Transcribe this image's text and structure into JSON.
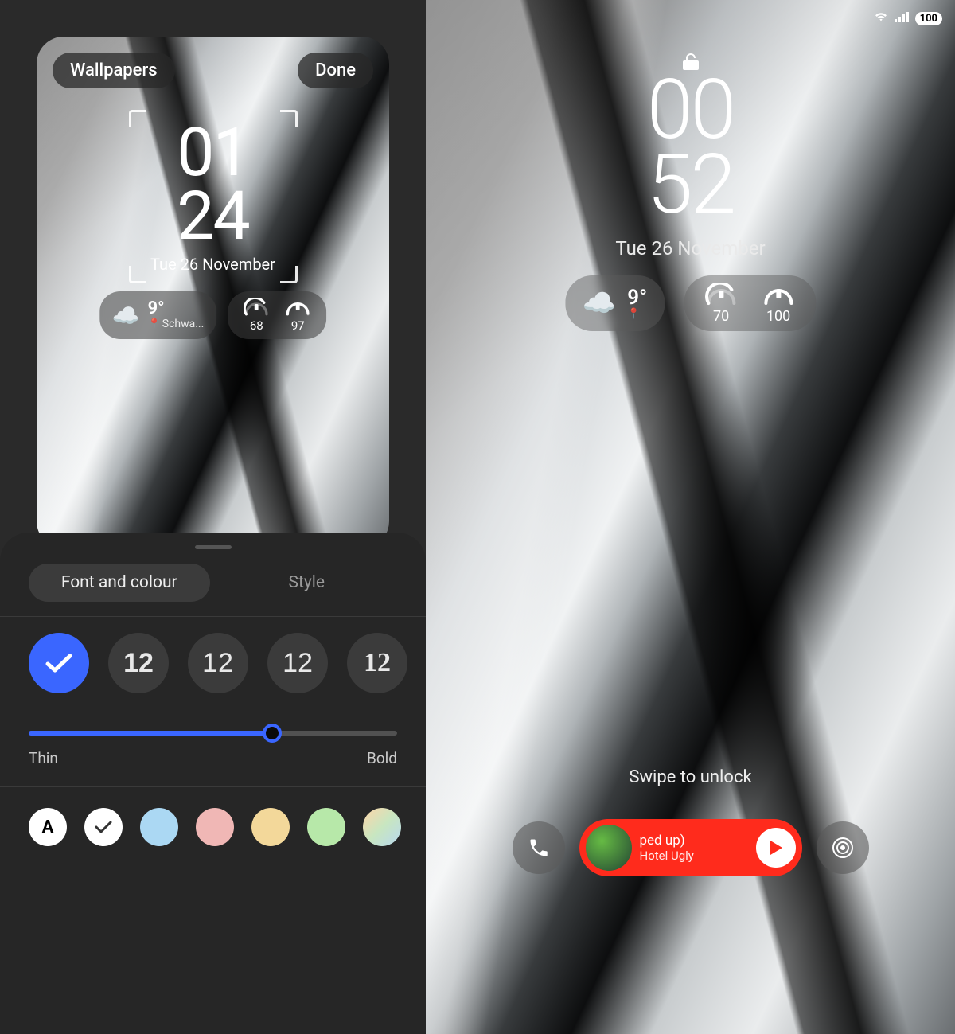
{
  "left": {
    "topbar": {
      "wallpapers": "Wallpapers",
      "done": "Done"
    },
    "clock": {
      "hh": "01",
      "mm": "24",
      "date": "Tue 26 November"
    },
    "weather": {
      "temp": "9°",
      "location": "Schwa..."
    },
    "rings": {
      "watch": "68",
      "phone": "97"
    },
    "sheet": {
      "tab_font": "Font and colour",
      "tab_style": "Style",
      "font_samples": [
        "✓",
        "12",
        "12",
        "12",
        "12"
      ],
      "weight": {
        "thin": "Thin",
        "bold": "Bold",
        "percent": 66
      },
      "colors": [
        {
          "bg": "#ffffff",
          "label": "A",
          "text": "#000"
        },
        {
          "bg": "#ffffff",
          "checked": true
        },
        {
          "bg": "#abd8f3"
        },
        {
          "bg": "#f0b7b5"
        },
        {
          "bg": "#f3d89a"
        },
        {
          "bg": "#b7e8a9"
        },
        {
          "bg": "linear-gradient(135deg,#ffd5a8,#c8e6c0,#b8d8f0)"
        }
      ]
    }
  },
  "right": {
    "status": {
      "battery": "100"
    },
    "clock": {
      "hh": "00",
      "mm": "52",
      "date": "Tue 26 November"
    },
    "weather": {
      "temp": "9°"
    },
    "rings": {
      "watch": "70",
      "phone": "100"
    },
    "swipe": "Swipe to unlock",
    "media": {
      "title": "ped up)",
      "artist": "Hotel Ugly"
    }
  }
}
